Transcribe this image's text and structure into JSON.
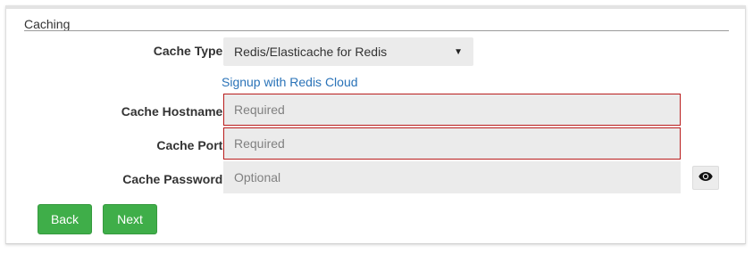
{
  "section": {
    "title": "Caching"
  },
  "fields": {
    "cache_type": {
      "label": "Cache Type:",
      "value": "Redis/Elasticache for Redis"
    },
    "signup_link": "Signup with Redis Cloud",
    "hostname": {
      "label": "Cache Hostname:",
      "placeholder": "Required"
    },
    "port": {
      "label": "Cache Port:",
      "placeholder": "Required"
    },
    "password": {
      "label": "Cache Password:",
      "placeholder": "Optional",
      "toggle_icon": "eye-icon"
    }
  },
  "buttons": {
    "back": "Back",
    "next": "Next"
  },
  "colors": {
    "button_green": "#3fae49",
    "link_blue": "#2a73b8",
    "error_border": "#b91c1c",
    "input_bg": "#ebebeb"
  }
}
